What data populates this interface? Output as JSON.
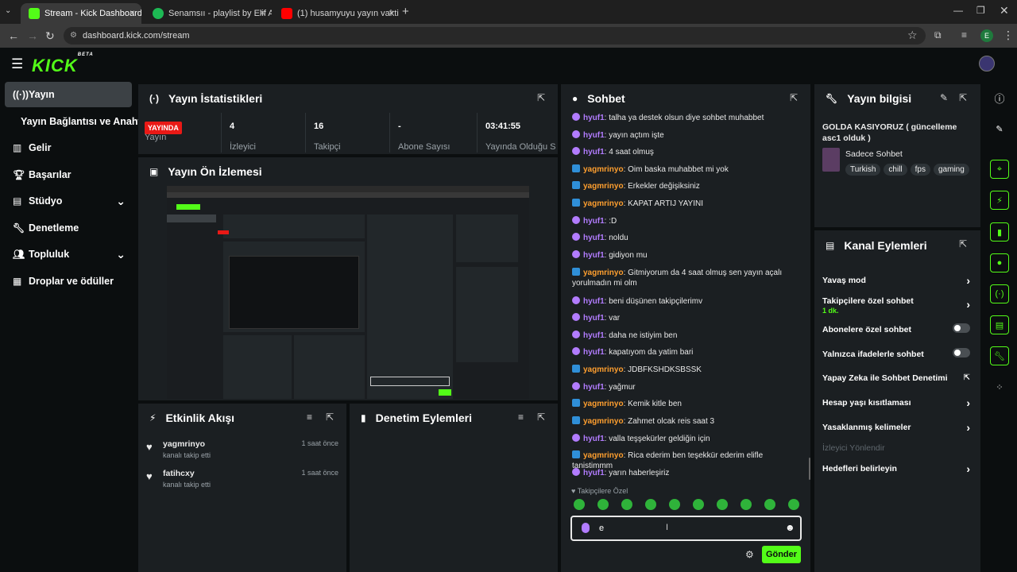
{
  "browser": {
    "tabs": [
      {
        "title": "Stream - Kick Dashboard",
        "active": true,
        "favicon": "kick-favicon"
      },
      {
        "title": "Senamsıı - playlist by Elif Aydo",
        "active": false,
        "favicon": "spotify-favicon"
      },
      {
        "title": "(1) husamyuyu yayın vakti",
        "active": false,
        "favicon": "youtube-favicon"
      }
    ],
    "url": "dashboard.kick.com/stream",
    "profile_initial": "E"
  },
  "app": {
    "logo": "KICK",
    "logo_sup": "BETA"
  },
  "sidebar": {
    "items": [
      {
        "label": "Yayın",
        "icon": "broadcast-icon",
        "active": true
      },
      {
        "label": "Yayın Bağlantısı ve Anahtarı",
        "icon": "",
        "active": false
      },
      {
        "label": "Gelir",
        "icon": "chart-icon",
        "active": false
      },
      {
        "label": "Başarılar",
        "icon": "trophy-icon",
        "active": false
      },
      {
        "label": "Stüdyo",
        "icon": "studio-icon",
        "active": false
      },
      {
        "label": "Denetleme",
        "icon": "wrench-icon",
        "active": false
      },
      {
        "label": "Topluluk",
        "icon": "people-icon",
        "active": false
      },
      {
        "label": "Droplar ve ödüller",
        "icon": "drops-icon",
        "active": false
      }
    ]
  },
  "stats": {
    "title": "Yayın İstatistikleri",
    "live_badge": "YAYINDA",
    "cells": [
      {
        "value": "",
        "label": "Yayın"
      },
      {
        "value": "4",
        "label": "İzleyici"
      },
      {
        "value": "16",
        "label": "Takipçi"
      },
      {
        "value": "-",
        "label": "Abone Sayısı"
      },
      {
        "value": "03:41:55",
        "label": "Yayında Olduğu Süre"
      }
    ]
  },
  "preview": {
    "title": "Yayın Ön İzlemesi"
  },
  "activity": {
    "title": "Etkinlik Akışı",
    "items": [
      {
        "user": "yagmrinyo",
        "action": "kanalı takip etti",
        "time": "1 saat önce"
      },
      {
        "user": "fatihcxy",
        "action": "kanalı takip etti",
        "time": "1 saat önce"
      }
    ]
  },
  "moderation": {
    "title": "Denetim Eylemleri"
  },
  "chat": {
    "title": "Sohbet",
    "messages": [
      {
        "user": "hyuf1",
        "text": "talha ya destek olsun diye sohbet muhabbet",
        "color": "#b27cff"
      },
      {
        "user": "hyuf1",
        "text": "yayın açtım işte",
        "color": "#b27cff"
      },
      {
        "user": "hyuf1",
        "text": "4 saat olmuş",
        "color": "#b27cff"
      },
      {
        "user": "yagmrinyo",
        "text": "Oim baska muhabbet mi yok",
        "color": "#ff9f2f"
      },
      {
        "user": "yagmrinyo",
        "text": "Erkekler değişiksiniz",
        "color": "#ff9f2f"
      },
      {
        "user": "yagmrinyo",
        "text": "KAPAT ARTIJ YAYINI",
        "color": "#ff9f2f"
      },
      {
        "user": "hyuf1",
        "text": ":D",
        "color": "#b27cff"
      },
      {
        "user": "hyuf1",
        "text": "noldu",
        "color": "#b27cff"
      },
      {
        "user": "hyuf1",
        "text": "gidiyon mu",
        "color": "#b27cff"
      },
      {
        "user": "yagmrinyo",
        "text": "Gitmiyorum da 4 saat olmuş sen yayın açalı yorulmadın mi olm",
        "color": "#ff9f2f"
      },
      {
        "user": "hyuf1",
        "text": "beni düşünen takipçilerimv",
        "color": "#b27cff"
      },
      {
        "user": "hyuf1",
        "text": "var",
        "color": "#b27cff"
      },
      {
        "user": "hyuf1",
        "text": "daha ne istiyim ben",
        "color": "#b27cff"
      },
      {
        "user": "hyuf1",
        "text": "kapatıyom da yatim bari",
        "color": "#b27cff"
      },
      {
        "user": "yagmrinyo",
        "text": "JDBFKSHDKSBSSK",
        "color": "#ff9f2f"
      },
      {
        "user": "hyuf1",
        "text": "yağmur",
        "color": "#b27cff"
      },
      {
        "user": "yagmrinyo",
        "text": "Kemik kitle ben",
        "color": "#ff9f2f"
      },
      {
        "user": "yagmrinyo",
        "text": "Zahmet olcak reis saat 3",
        "color": "#ff9f2f"
      },
      {
        "user": "hyuf1",
        "text": "valla teşşekürler geldiğin için",
        "color": "#b27cff"
      },
      {
        "user": "yagmrinyo",
        "text": "Rica ederim ben teşekkür ederim elifle tanistimmm",
        "color": "#ff9f2f"
      },
      {
        "user": "hyuf1",
        "text": "yarın haberleşiriz",
        "color": "#b27cff"
      }
    ],
    "followers_only_label": "Takipçilere Özel",
    "input_value": "e",
    "send_label": "Gönder"
  },
  "stream_info": {
    "title": "Yayın bilgisi",
    "stream_title": "GOLDA KASIYORUZ ( güncelleme asc1 olduk )",
    "category": "Sadece Sohbet",
    "tags": [
      "Turkish",
      "chill",
      "fps",
      "gaming"
    ]
  },
  "channel_actions": {
    "title": "Kanal Eylemleri",
    "rows": [
      {
        "label": "Yavaş mod",
        "control": "arrow"
      },
      {
        "label": "Takipçilere özel sohbet",
        "sub": "1 dk.",
        "control": "arrow"
      },
      {
        "label": "Abonelere özel sohbet",
        "control": "toggle"
      },
      {
        "label": "Yalnızca ifadelerle sohbet",
        "control": "toggle"
      },
      {
        "label": "Yapay Zeka ile Sohbet Denetimi",
        "control": "external"
      },
      {
        "label": "Hesap yaşı kısıtlaması",
        "control": "arrow"
      },
      {
        "label": "Yasaklanmış kelimeler",
        "control": "arrow"
      },
      {
        "label": "İzleyici Yönlendir",
        "control": "none",
        "disabled": true
      },
      {
        "label": "Hedefleri belirleyin",
        "control": "arrow"
      }
    ]
  },
  "colors": {
    "accent": "#53fc18",
    "live": "#e91916",
    "panel": "#1b1f22",
    "background": "#0b0e0f"
  }
}
